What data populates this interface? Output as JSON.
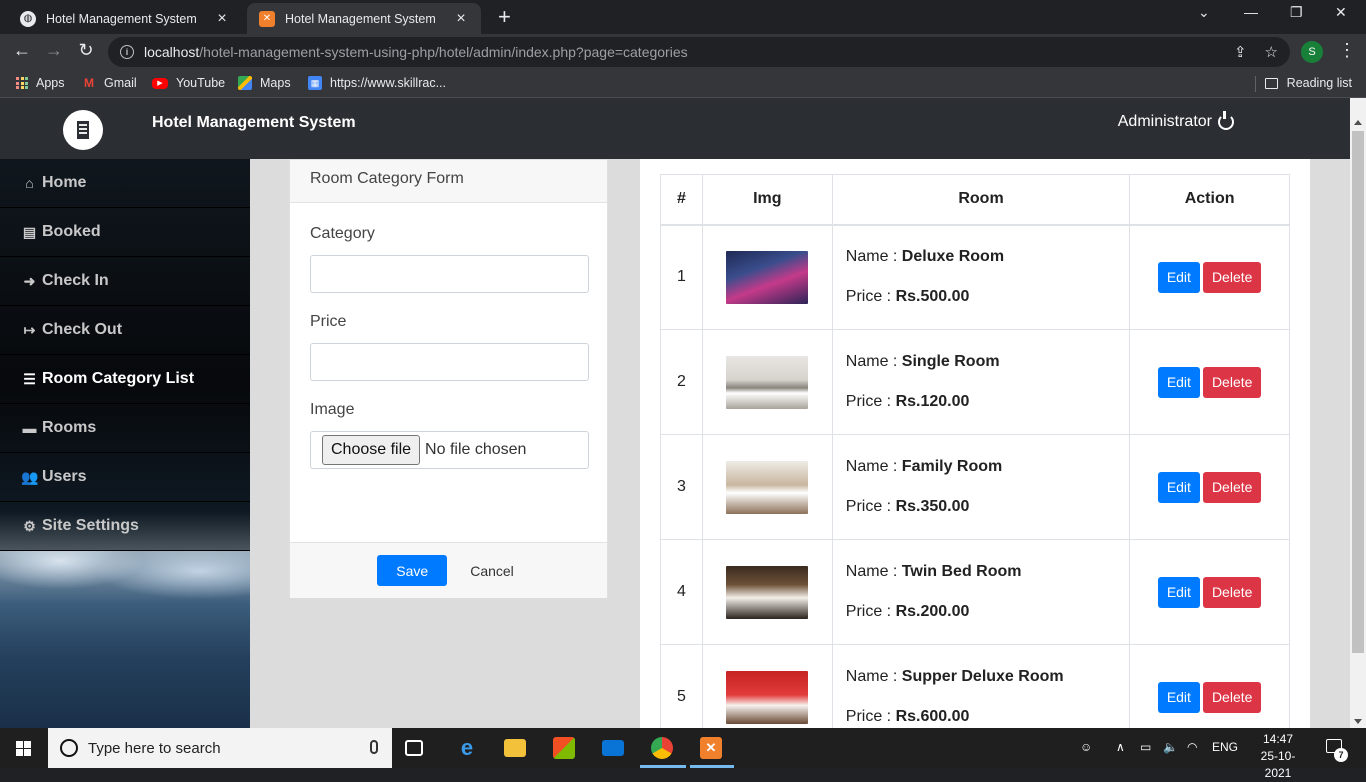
{
  "browser": {
    "tabs": [
      {
        "title": "Hotel Management System",
        "active": false,
        "favicon": "globe-icon"
      },
      {
        "title": "Hotel Management System",
        "active": true,
        "favicon": "xampp-icon"
      }
    ],
    "new_tab": "+",
    "window_controls": {
      "dropdown": "⌄",
      "minimize": "—",
      "restore": "❐",
      "close": "✕"
    },
    "url_host": "localhost",
    "url_path": "/hotel-management-system-using-php/hotel/admin/index.php?page=categories",
    "profile_initial": "S",
    "bookmarks": [
      {
        "label": "Apps",
        "icon": "apps-grid-icon"
      },
      {
        "label": "Gmail",
        "icon": "gmail-icon",
        "color": "#ea4335"
      },
      {
        "label": "YouTube",
        "icon": "youtube-icon",
        "color": "#ff0000"
      },
      {
        "label": "Maps",
        "icon": "maps-icon",
        "color": "#34a853"
      },
      {
        "label": "https://www.skillrac...",
        "icon": "skillrack-icon",
        "color": "#4285f4"
      }
    ],
    "reading_list": "Reading list"
  },
  "app": {
    "brand": "Hotel Management System",
    "user": "Administrator",
    "sidebar": [
      {
        "label": "Home",
        "icon": "home-icon",
        "glyph": "⌂",
        "active": false
      },
      {
        "label": "Booked",
        "icon": "booked-icon",
        "glyph": "▤",
        "active": false
      },
      {
        "label": "Check In",
        "icon": "sign-in-icon",
        "glyph": "➜",
        "active": false
      },
      {
        "label": "Check Out",
        "icon": "sign-out-icon",
        "glyph": "↦",
        "active": false
      },
      {
        "label": "Room Category List",
        "icon": "list-icon",
        "glyph": "☰",
        "active": true
      },
      {
        "label": "Rooms",
        "icon": "bed-icon",
        "glyph": "▬",
        "active": false
      },
      {
        "label": "Users",
        "icon": "users-icon",
        "glyph": "👥",
        "active": false
      },
      {
        "label": "Site Settings",
        "icon": "cogs-icon",
        "glyph": "⚙",
        "active": false
      }
    ],
    "form": {
      "title": "Room Category Form",
      "category_label": "Category",
      "category_value": "",
      "price_label": "Price",
      "price_value": "",
      "image_label": "Image",
      "choose_file": "Choose file",
      "no_file": "No file chosen",
      "save": "Save",
      "cancel": "Cancel"
    },
    "table": {
      "headers": [
        "#",
        "Img",
        "Room",
        "Action"
      ],
      "name_prefix": "Name : ",
      "price_prefix": "Price : ",
      "edit": "Edit",
      "delete": "Delete",
      "rows": [
        {
          "num": "1",
          "name": "Deluxe Room",
          "price": "Rs.500.00"
        },
        {
          "num": "2",
          "name": "Single Room",
          "price": "Rs.120.00"
        },
        {
          "num": "3",
          "name": "Family Room",
          "price": "Rs.350.00"
        },
        {
          "num": "4",
          "name": "Twin Bed Room",
          "price": "Rs.200.00"
        },
        {
          "num": "5",
          "name": "Supper Deluxe Room",
          "price": "Rs.600.00"
        }
      ]
    }
  },
  "taskbar": {
    "search_placeholder": "Type here to search",
    "language": "ENG",
    "time": "14:47",
    "date": "25-10-2021",
    "notification_count": "7"
  }
}
